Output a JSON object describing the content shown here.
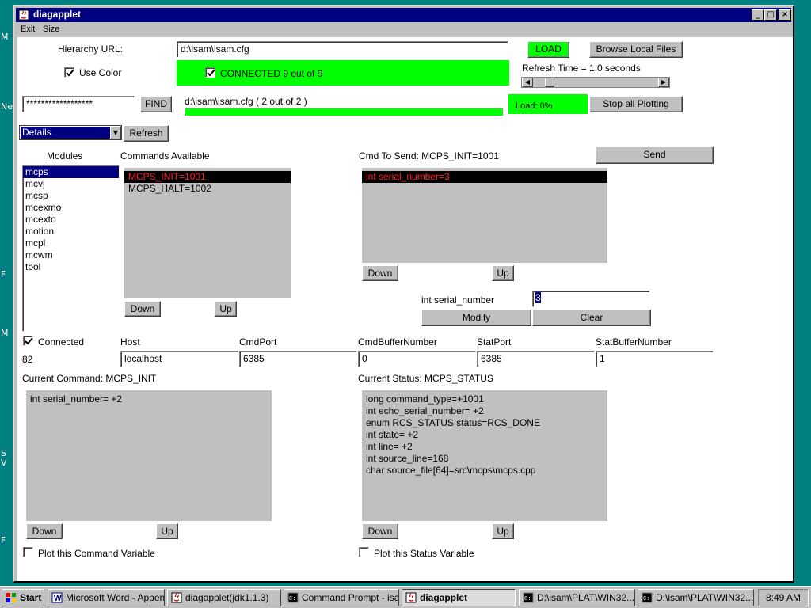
{
  "desktop_fragments": [
    "M",
    "Ne",
    "F",
    "M",
    "S",
    "V",
    "F"
  ],
  "window": {
    "title": "diagapplet",
    "menu": [
      "Exit",
      "Size"
    ]
  },
  "hierarchy": {
    "label": "Hierarchy URL:",
    "value": "d:\\isam\\isam.cfg",
    "load_label": "LOAD",
    "browse_label": "Browse Local Files",
    "use_color_label": "Use Color",
    "use_color_checked": true
  },
  "connection": {
    "status_text": "CONNECTED 9 out of 9",
    "checked": true,
    "refresh_time_label": "Refresh Time  = 1.0 seconds",
    "refresh_slider_value": 0.1
  },
  "search": {
    "value": "******************",
    "find_label": "FIND"
  },
  "progress": {
    "label": "d:\\isam\\isam.cfg ( 2 out of 2 )",
    "fraction": 1.0,
    "load_label": "Load: 0%",
    "stop_label": "Stop all Plotting"
  },
  "view": {
    "selected": "Details",
    "refresh_label": "Refresh"
  },
  "modules": {
    "header": "Modules",
    "items": [
      "mcps",
      "mcvj",
      "mcsp",
      "mcexmo",
      "mcexto",
      "motion",
      "mcpl",
      "mcwm",
      "tool"
    ],
    "selected_index": 0
  },
  "commands": {
    "header": "Commands Available",
    "items": [
      "MCPS_INIT=1001",
      "MCPS_HALT=1002"
    ],
    "selected_index": 0,
    "down_label": "Down",
    "up_label": "Up"
  },
  "cmd_to_send": {
    "header": "Cmd To Send: MCPS_INIT=1001",
    "send_label": "Send",
    "items": [
      "int serial_number=3"
    ],
    "selected_index": 0,
    "down_label": "Down",
    "up_label": "Up",
    "field_label": "int serial_number",
    "field_value": "3",
    "modify_label": "Modify",
    "clear_label": "Clear"
  },
  "connected": {
    "label": "Connected",
    "checked": true,
    "id_value": "82"
  },
  "connection_fields": {
    "host_label": "Host",
    "host_value": "localhost",
    "cmdport_label": "CmdPort",
    "cmdport_value": "6385",
    "cmdbuf_label": "CmdBufferNumber",
    "cmdbuf_value": "0",
    "statport_label": "StatPort",
    "statport_value": "6385",
    "statbuf_label": "StatBufferNumber",
    "statbuf_value": "1"
  },
  "current_command": {
    "header": "Current Command: MCPS_INIT",
    "lines": [
      "int serial_number=    +2"
    ],
    "down_label": "Down",
    "up_label": "Up",
    "plot_label": "Plot this Command Variable",
    "plot_checked": false
  },
  "current_status": {
    "header": "Current Status: MCPS_STATUS",
    "lines": [
      "long command_type=+1001",
      "int echo_serial_number=    +2",
      "enum RCS_STATUS status=RCS_DONE",
      "int state=    +2",
      "int line=    +2",
      "int source_line=168",
      "char source_file[64]=src\\mcps\\mcps.cpp"
    ],
    "down_label": "Down",
    "up_label": "Up",
    "plot_label": "Plot this Status Variable",
    "plot_checked": false
  },
  "taskbar": {
    "start_label": "Start",
    "tasks": [
      {
        "label": "Microsoft Word - Appen...",
        "icon": "word-icon",
        "active": false
      },
      {
        "label": "diagapplet(jdk1.1.3)",
        "icon": "java-icon",
        "active": false
      },
      {
        "label": "Command Prompt - isam...",
        "icon": "command-prompt-icon",
        "active": false
      },
      {
        "label": "diagapplet",
        "icon": "java-icon",
        "active": true
      },
      {
        "label": "D:\\isam\\PLAT\\WIN32...",
        "icon": "command-prompt-icon",
        "active": false
      },
      {
        "label": "D:\\isam\\PLAT\\WIN32...",
        "icon": "command-prompt-icon",
        "active": false
      }
    ],
    "clock": "8:49 AM"
  },
  "colors": {
    "desktop": "#008080",
    "titlebar": "#000080",
    "status_green": "#00ff00",
    "selected_command_text": "#ff2020"
  }
}
